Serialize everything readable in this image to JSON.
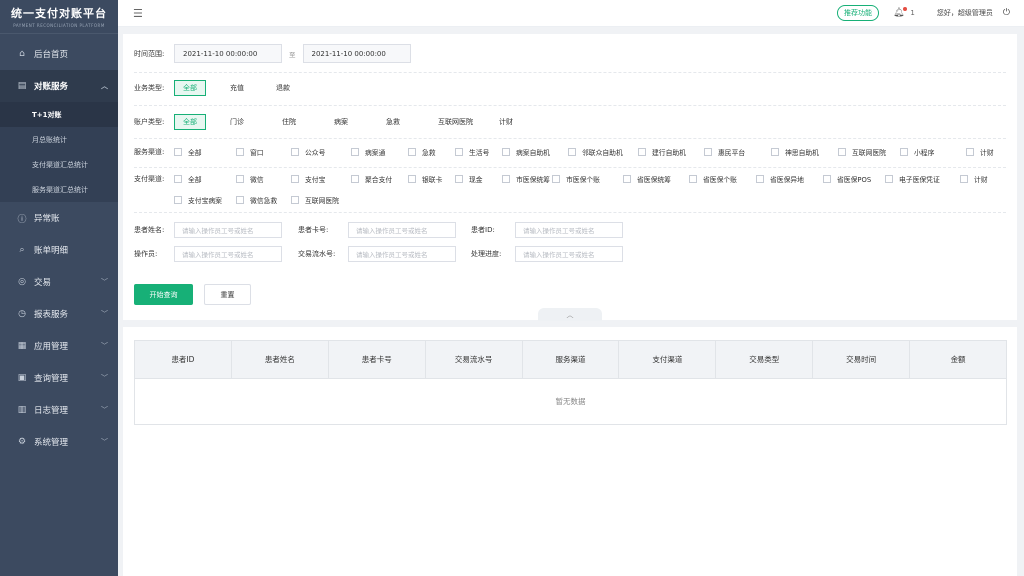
{
  "brand": {
    "title": "统一支付对账平台",
    "subtitle": "PAYMENT RECONCILIATION PLATFORM"
  },
  "sidebar": {
    "items": [
      {
        "label": "后台首页",
        "icon": "home-icon"
      },
      {
        "label": "对账服务",
        "icon": "document-icon",
        "expanded": true
      },
      {
        "label": "异常账",
        "icon": "alert-circle-icon"
      },
      {
        "label": "账单明细",
        "icon": "search-icon"
      },
      {
        "label": "交易",
        "icon": "coin-icon"
      },
      {
        "label": "报表服务",
        "icon": "chart-icon"
      },
      {
        "label": "应用管理",
        "icon": "grid-icon"
      },
      {
        "label": "查询管理",
        "icon": "monitor-icon"
      },
      {
        "label": "日志管理",
        "icon": "log-icon"
      },
      {
        "label": "系统管理",
        "icon": "gear-icon"
      }
    ],
    "subitems": [
      "T+1对账",
      "月总账统计",
      "支付渠道汇总统计",
      "服务渠道汇总统计"
    ]
  },
  "topbar": {
    "recommend": "推荐功能",
    "notification_count": "1",
    "greeting": "您好，超级管理员"
  },
  "filters": {
    "time_label": "时间范围:",
    "time_start": "2021-11-10   00:00:00",
    "time_sep": "至",
    "time_end": "2021-11-10   00:00:00",
    "business_label": "业务类型:",
    "business_options": [
      "全部",
      "充值",
      "退款"
    ],
    "account_label": "账户类型:",
    "account_options": [
      "全部",
      "门诊",
      "住院",
      "病案",
      "急救",
      "互联网医院",
      "计财"
    ],
    "service_label": "服务渠道:",
    "service_options": [
      "全部",
      "窗口",
      "公众号",
      "病案通",
      "急救",
      "生活号",
      "病案自助机",
      "邻联众自助机",
      "建行自助机",
      "惠民平台",
      "神思自助机",
      "互联网医院",
      "小程序",
      "计财"
    ],
    "pay_label": "支付渠道:",
    "pay_options_row1": [
      "全部",
      "微信",
      "支付宝",
      "聚合支付",
      "银联卡",
      "现金",
      "市医保统筹",
      "市医保个账",
      "省医保统筹",
      "省医保个账",
      "省医保异地",
      "省医保POS",
      "电子医保凭证",
      "计财"
    ],
    "pay_options_row2": [
      "支付宝病案",
      "微信急救",
      "互联网医院"
    ],
    "patient_name_label": "患者姓名:",
    "patient_card_label": "患者卡号:",
    "patient_id_label": "患者ID:",
    "operator_label": "操作员:",
    "serial_label": "交易流水号:",
    "progress_label": "处理进度:",
    "input_placeholder": "请输入操作员工号或姓名",
    "search_button": "开始查询",
    "reset_button": "重置"
  },
  "table": {
    "columns": [
      "患者ID",
      "患者姓名",
      "患者卡号",
      "交易流水号",
      "服务渠道",
      "支付渠道",
      "交易类型",
      "交易时间",
      "金额"
    ],
    "empty_text": "暂无数据"
  },
  "colors": {
    "accent": "#17b077",
    "sidebar": "#3c4a60"
  }
}
